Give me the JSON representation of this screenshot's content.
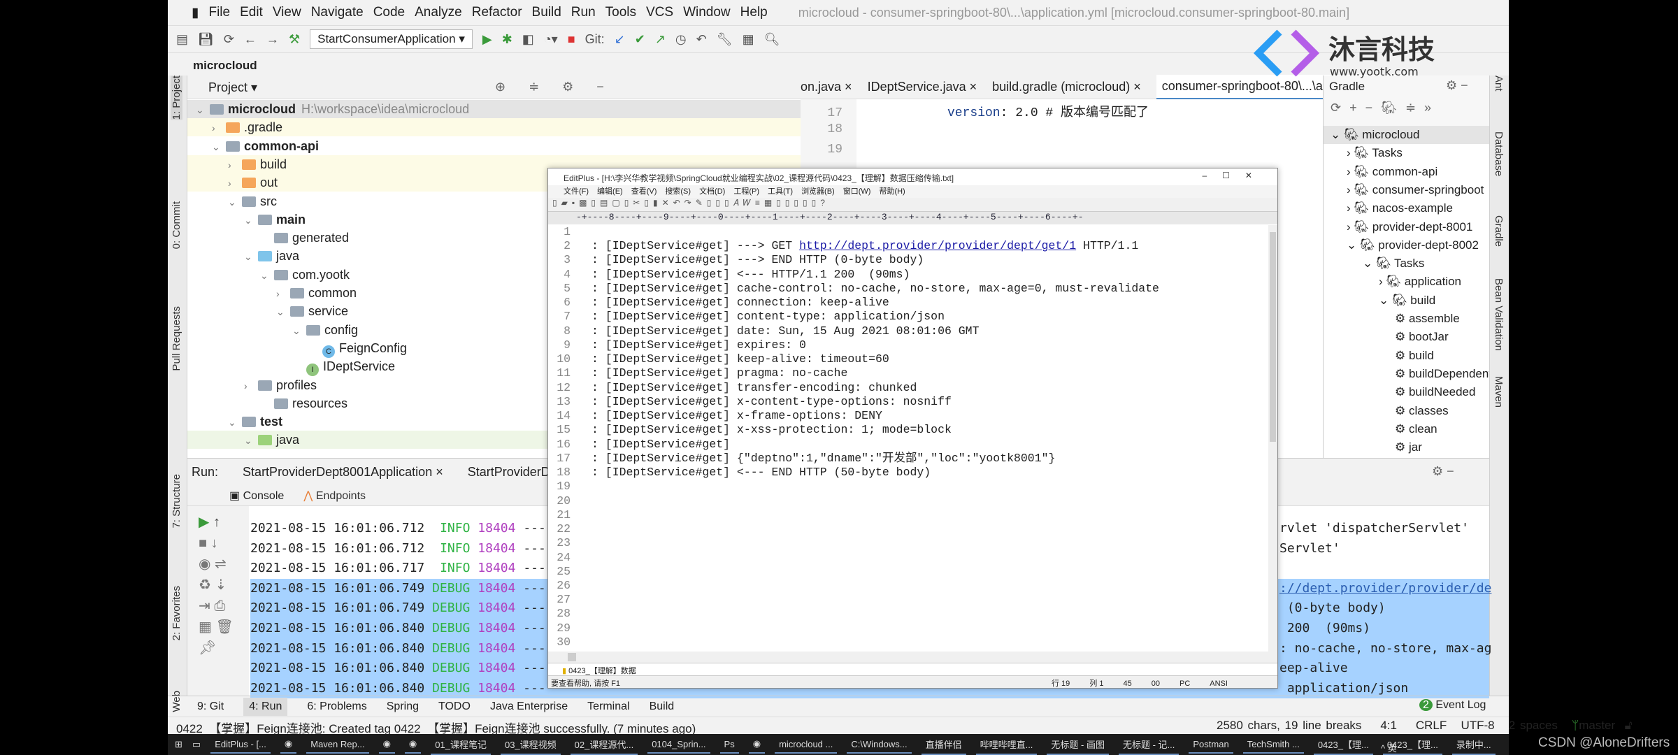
{
  "window": {
    "title": "microcloud - consumer-springboot-80\\...\\application.yml [microcloud.consumer-springboot-80.main]"
  },
  "menu": [
    "File",
    "Edit",
    "View",
    "Navigate",
    "Code",
    "Analyze",
    "Refactor",
    "Build",
    "Run",
    "Tools",
    "VCS",
    "Window",
    "Help"
  ],
  "toolbar": {
    "run_config": "StartConsumerApplication",
    "git_label": "Git:"
  },
  "watermark": {
    "brand": "沐言科技",
    "url": "www.yootk.com",
    "overlay": "YOOTK沐言优拓"
  },
  "breadcrumb": "microcloud",
  "project": {
    "title": "Project",
    "tree": [
      {
        "label": "microcloud",
        "extra": "H:\\workspace\\idea\\microcloud",
        "depth": 0,
        "arrow": "v",
        "bold": true,
        "hl": ""
      },
      {
        "label": ".gradle",
        "depth": 1,
        "arrow": ">",
        "hl": "#fdfbe6",
        "icon": "#f5a65b"
      },
      {
        "label": "common-api",
        "depth": 1,
        "arrow": "v",
        "bold": true
      },
      {
        "label": "build",
        "depth": 2,
        "arrow": ">",
        "hl": "#fdfbe6",
        "icon": "#f5a65b"
      },
      {
        "label": "out",
        "depth": 2,
        "arrow": ">",
        "hl": "#fdfbe6",
        "icon": "#f5a65b"
      },
      {
        "label": "src",
        "depth": 2,
        "arrow": "v"
      },
      {
        "label": "main",
        "depth": 3,
        "arrow": "v",
        "bold": true
      },
      {
        "label": "generated",
        "depth": 4,
        "arrow": ""
      },
      {
        "label": "java",
        "depth": 3,
        "arrow": "v",
        "icon": "#7fc4ea"
      },
      {
        "label": "com.yootk",
        "depth": 4,
        "arrow": "v"
      },
      {
        "label": "common",
        "depth": 5,
        "arrow": ">"
      },
      {
        "label": "service",
        "depth": 5,
        "arrow": "v"
      },
      {
        "label": "config",
        "depth": 6,
        "arrow": "v"
      },
      {
        "label": "FeignConfig",
        "depth": 7,
        "arrow": "",
        "icon": "#6fb9e8",
        "round": "C"
      },
      {
        "label": "IDeptService",
        "depth": 6,
        "arrow": "",
        "icon": "#8fc47c",
        "round": "I"
      },
      {
        "label": "profiles",
        "depth": 3,
        "arrow": ">"
      },
      {
        "label": "resources",
        "depth": 4,
        "arrow": ""
      },
      {
        "label": "test",
        "depth": 2,
        "arrow": "v",
        "bold": true
      },
      {
        "label": "java",
        "depth": 3,
        "arrow": "v",
        "hl": "#eef6e6",
        "icon": "#9cd27a"
      }
    ]
  },
  "left_strip": [
    "1: Project",
    "0: Commit",
    "Pull Requests",
    "7: Structure",
    "2: Favorites",
    "Web"
  ],
  "right_strip": [
    "Ant",
    "Database",
    "Gradle",
    "Bean Validation",
    "Maven"
  ],
  "editor": {
    "tabs": [
      "on.java",
      "IDeptService.java",
      "build.gradle (microcloud)",
      "consumer-springboot-80\\...\\application.yml"
    ],
    "lines": [
      {
        "n": "17",
        "key": "version",
        "rest": ": 2.0 # 版本编号匹配了"
      },
      {
        "n": "18",
        "key": "",
        "rest": ""
      },
      {
        "n": "19",
        "key": "",
        "rest": ""
      }
    ],
    "inspection_count": "2"
  },
  "gradle": {
    "title": "Gradle",
    "tree": [
      {
        "label": "microcloud",
        "depth": 0,
        "arrow": "v"
      },
      {
        "label": "Tasks",
        "depth": 1,
        "arrow": ">"
      },
      {
        "label": "common-api",
        "depth": 1,
        "arrow": ">"
      },
      {
        "label": "consumer-springboot",
        "depth": 1,
        "arrow": ">"
      },
      {
        "label": "nacos-example",
        "depth": 1,
        "arrow": ">"
      },
      {
        "label": "provider-dept-8001",
        "depth": 1,
        "arrow": ">"
      },
      {
        "label": "provider-dept-8002",
        "depth": 1,
        "arrow": "v"
      },
      {
        "label": "Tasks",
        "depth": 2,
        "arrow": "v"
      },
      {
        "label": "application",
        "depth": 3,
        "arrow": ">"
      },
      {
        "label": "build",
        "depth": 3,
        "arrow": "v"
      },
      {
        "label": "assemble",
        "depth": 4,
        "arrow": ""
      },
      {
        "label": "bootJar",
        "depth": 4,
        "arrow": ""
      },
      {
        "label": "build",
        "depth": 4,
        "arrow": ""
      },
      {
        "label": "buildDependents",
        "depth": 4,
        "arrow": ""
      },
      {
        "label": "buildNeeded",
        "depth": 4,
        "arrow": ""
      },
      {
        "label": "classes",
        "depth": 4,
        "arrow": ""
      },
      {
        "label": "clean",
        "depth": 4,
        "arrow": ""
      },
      {
        "label": "jar",
        "depth": 4,
        "arrow": ""
      }
    ]
  },
  "run": {
    "label": "Run:",
    "tabs": [
      "StartProviderDept8001Application",
      "StartProviderDept8002Application"
    ],
    "console_tab": "Console",
    "endpoints_tab": "Endpoints",
    "lines": [
      {
        "time": "2021-08-15 16:01:06.712",
        "level": "INFO",
        "pid": "18404",
        "sep": "---",
        "tail": "rvlet 'dispatcherServlet'",
        "sel": false
      },
      {
        "time": "2021-08-15 16:01:06.712",
        "level": "INFO",
        "pid": "18404",
        "sep": "---",
        "tail": "Servlet'",
        "sel": false
      },
      {
        "time": "2021-08-15 16:01:06.717",
        "level": "INFO",
        "pid": "18404",
        "sep": "---",
        "tail": "",
        "sel": false
      },
      {
        "time": "2021-08-15 16:01:06.749",
        "level": "DEBUG",
        "pid": "18404",
        "sep": "---",
        "tail": "://dept.provider/provider/de",
        "sel": true,
        "link": true
      },
      {
        "time": "2021-08-15 16:01:06.749",
        "level": "DEBUG",
        "pid": "18404",
        "sep": "---",
        "tail": " (0-byte body)",
        "sel": true
      },
      {
        "time": "2021-08-15 16:01:06.840",
        "level": "DEBUG",
        "pid": "18404",
        "sep": "---",
        "tail": " 200  (90ms)",
        "sel": true
      },
      {
        "time": "2021-08-15 16:01:06.840",
        "level": "DEBUG",
        "pid": "18404",
        "sep": "---",
        "tail": ": no-cache, no-store, max-ag",
        "sel": true
      },
      {
        "time": "2021-08-15 16:01:06.840",
        "level": "DEBUG",
        "pid": "18404",
        "sep": "---",
        "tail": "eep-alive",
        "sel": true
      },
      {
        "time": "2021-08-15 16:01:06.840",
        "level": "DEBUG",
        "pid": "18404",
        "sep": "---",
        "tail": " application/json",
        "sel": true
      }
    ],
    "colors": {
      "info": "#2fb344",
      "debug": "#2fb344",
      "pid": "#b040c0",
      "selection": "#a6d2ff"
    }
  },
  "bottom_tabs": [
    "9: Git",
    "4: Run",
    "6: Problems",
    "Spring",
    "TODO",
    "Java Enterprise",
    "Terminal",
    "Build"
  ],
  "event_log": {
    "count": "2",
    "label": "Event Log"
  },
  "status": {
    "message": "0422_【掌握】Feign连接池: Created tag 0422_【掌握】Feign连接池 successfully. (7 minutes ago)",
    "chars": "2580 chars, 19 line breaks",
    "pos": "4:1",
    "eol": "CRLF",
    "enc": "UTF-8",
    "indent": "2 spaces",
    "branch": "master"
  },
  "editplus": {
    "title": "EditPlus - [H:\\李兴华教学视频\\SpringCloud就业编程实战\\02_课程源代码\\0423_【理解】数据压缩传输.txt]",
    "menu": [
      "文件(F)",
      "编辑(E)",
      "查看(V)",
      "搜索(S)",
      "文档(D)",
      "工程(P)",
      "工具(T)",
      "浏览器(B)",
      "窗口(W)",
      "帮助(H)"
    ],
    "ruler": "-+----8----+----9----+----0----+----1----+----2----+----3----+----4----+----5----+----6----+-",
    "lines": [
      "",
      ": [IDeptService#get] ---> GET |http://dept.provider/provider/dept/get/1| HTTP/1.1",
      ": [IDeptService#get] ---> END HTTP (0-byte body)",
      ": [IDeptService#get] <--- HTTP/1.1 200  (90ms)",
      ": [IDeptService#get] cache-control: no-cache, no-store, max-age=0, must-revalidate",
      ": [IDeptService#get] connection: keep-alive",
      ": [IDeptService#get] content-type: application/json",
      ": [IDeptService#get] date: Sun, 15 Aug 2021 08:01:06 GMT",
      ": [IDeptService#get] expires: 0",
      ": [IDeptService#get] keep-alive: timeout=60",
      ": [IDeptService#get] pragma: no-cache",
      ": [IDeptService#get] transfer-encoding: chunked",
      ": [IDeptService#get] x-content-type-options: nosniff",
      ": [IDeptService#get] x-frame-options: DENY",
      ": [IDeptService#get] x-xss-protection: 1; mode=block",
      ": [IDeptService#get]",
      ": [IDeptService#get] {\"deptno\":1,\"dname\":\"开发部\",\"loc\":\"yootk8001\"}",
      ": [IDeptService#get] <--- END HTTP (50-byte body)",
      "",
      "",
      "",
      "",
      "",
      "",
      "",
      "",
      "",
      "",
      "",
      ""
    ],
    "doc_tab": "0423_【理解】数据",
    "help": "要查看帮助, 请按 F1",
    "status": [
      "行 19",
      "列 1",
      "45",
      "00",
      "PC",
      "ANSI"
    ]
  },
  "taskbar": [
    "EditPlus - [...",
    "",
    "Maven Rep...",
    "",
    "",
    "01_课程笔记",
    "03_课程视频",
    "02_课程源代...",
    "0104_Sprin...",
    "Ps",
    "",
    "microcloud ...",
    "C:\\Windows...",
    "直播伴侣",
    "哔哩哔哩直...",
    "无标题 - 画图",
    "无标题 - 记...",
    "Postman",
    "TechSmith ...",
    "0423_【理...",
    "0423_【理...",
    "录制中..."
  ],
  "tray": "^ 英",
  "csdn": "CSDN @AloneDrifters"
}
